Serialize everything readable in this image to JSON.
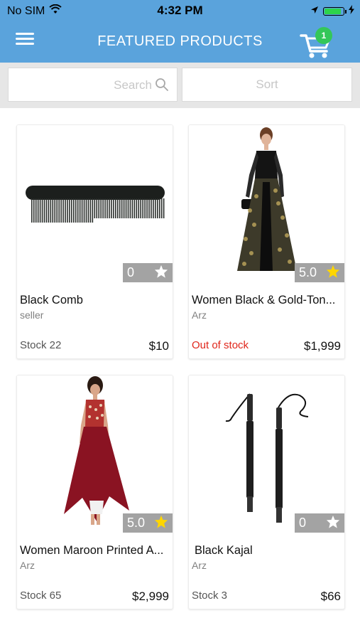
{
  "status_bar": {
    "carrier": "No SIM",
    "time": "4:32 PM",
    "battery_level": 0.9
  },
  "header": {
    "title": "FEATURED PRODUCTS",
    "cart_count": "1"
  },
  "toolbar": {
    "search_placeholder": "Search",
    "sort_label": "Sort"
  },
  "colors": {
    "header_bg": "#5aa3dc",
    "badge": "#34c759",
    "out_of_stock": "#e0261b",
    "star_filled": "#ffd600",
    "star_empty": "#ffffff"
  },
  "products": [
    {
      "name": "Black Comb",
      "seller": "seller",
      "stock": "Stock 22",
      "price": "$10",
      "rating": "0",
      "rated": false,
      "image_icon": "comb-image"
    },
    {
      "name": "Women Black & Gold-Ton...",
      "seller": "Arz",
      "stock": "Out of stock",
      "price": "$1,999",
      "rating": "5.0",
      "rated": true,
      "image_icon": "dress-image"
    },
    {
      "name": "Women Maroon Printed A...",
      "seller": "Arz",
      "stock": "Stock 65",
      "price": "$2,999",
      "rating": "5.0",
      "rated": true,
      "image_icon": "maroon-dress-image"
    },
    {
      "name": "Black Kajal",
      "seller": "Arz",
      "stock": "Stock 3",
      "price": "$66",
      "rating": "0",
      "rated": false,
      "image_icon": "kajal-image"
    }
  ]
}
